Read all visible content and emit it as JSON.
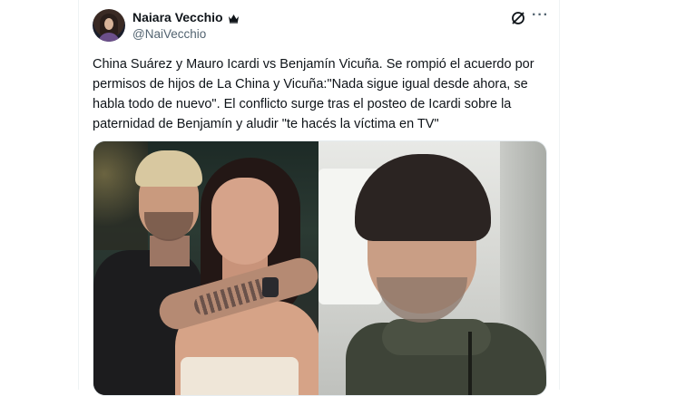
{
  "author": {
    "display_name": "Naiara Vecchio",
    "handle": "@NaiVecchio",
    "badge_icon": "crown-icon",
    "avatar_icon": "avatar-portrait"
  },
  "header_actions": {
    "grok_icon": "grok-icon",
    "more_label": "···"
  },
  "tweet": {
    "text": "China Suárez y Mauro Icardi vs Benjamín Vicuña. Se rompió el acuerdo por\npermisos de hijos de La China y Vicuña:\"Nada sigue igual desde ahora, se\nhabla todo de nuevo\". El conflicto surge tras el posteo de Icardi sobre la\npaternidad de Benjamín y aludir \"te hacés la víctima en TV\""
  },
  "media": {
    "left_photo": "couple-photo",
    "right_photo": "man-in-car-photo"
  },
  "colors": {
    "text_primary": "#0f1419",
    "text_secondary": "#536471",
    "border": "#eff3f4"
  }
}
